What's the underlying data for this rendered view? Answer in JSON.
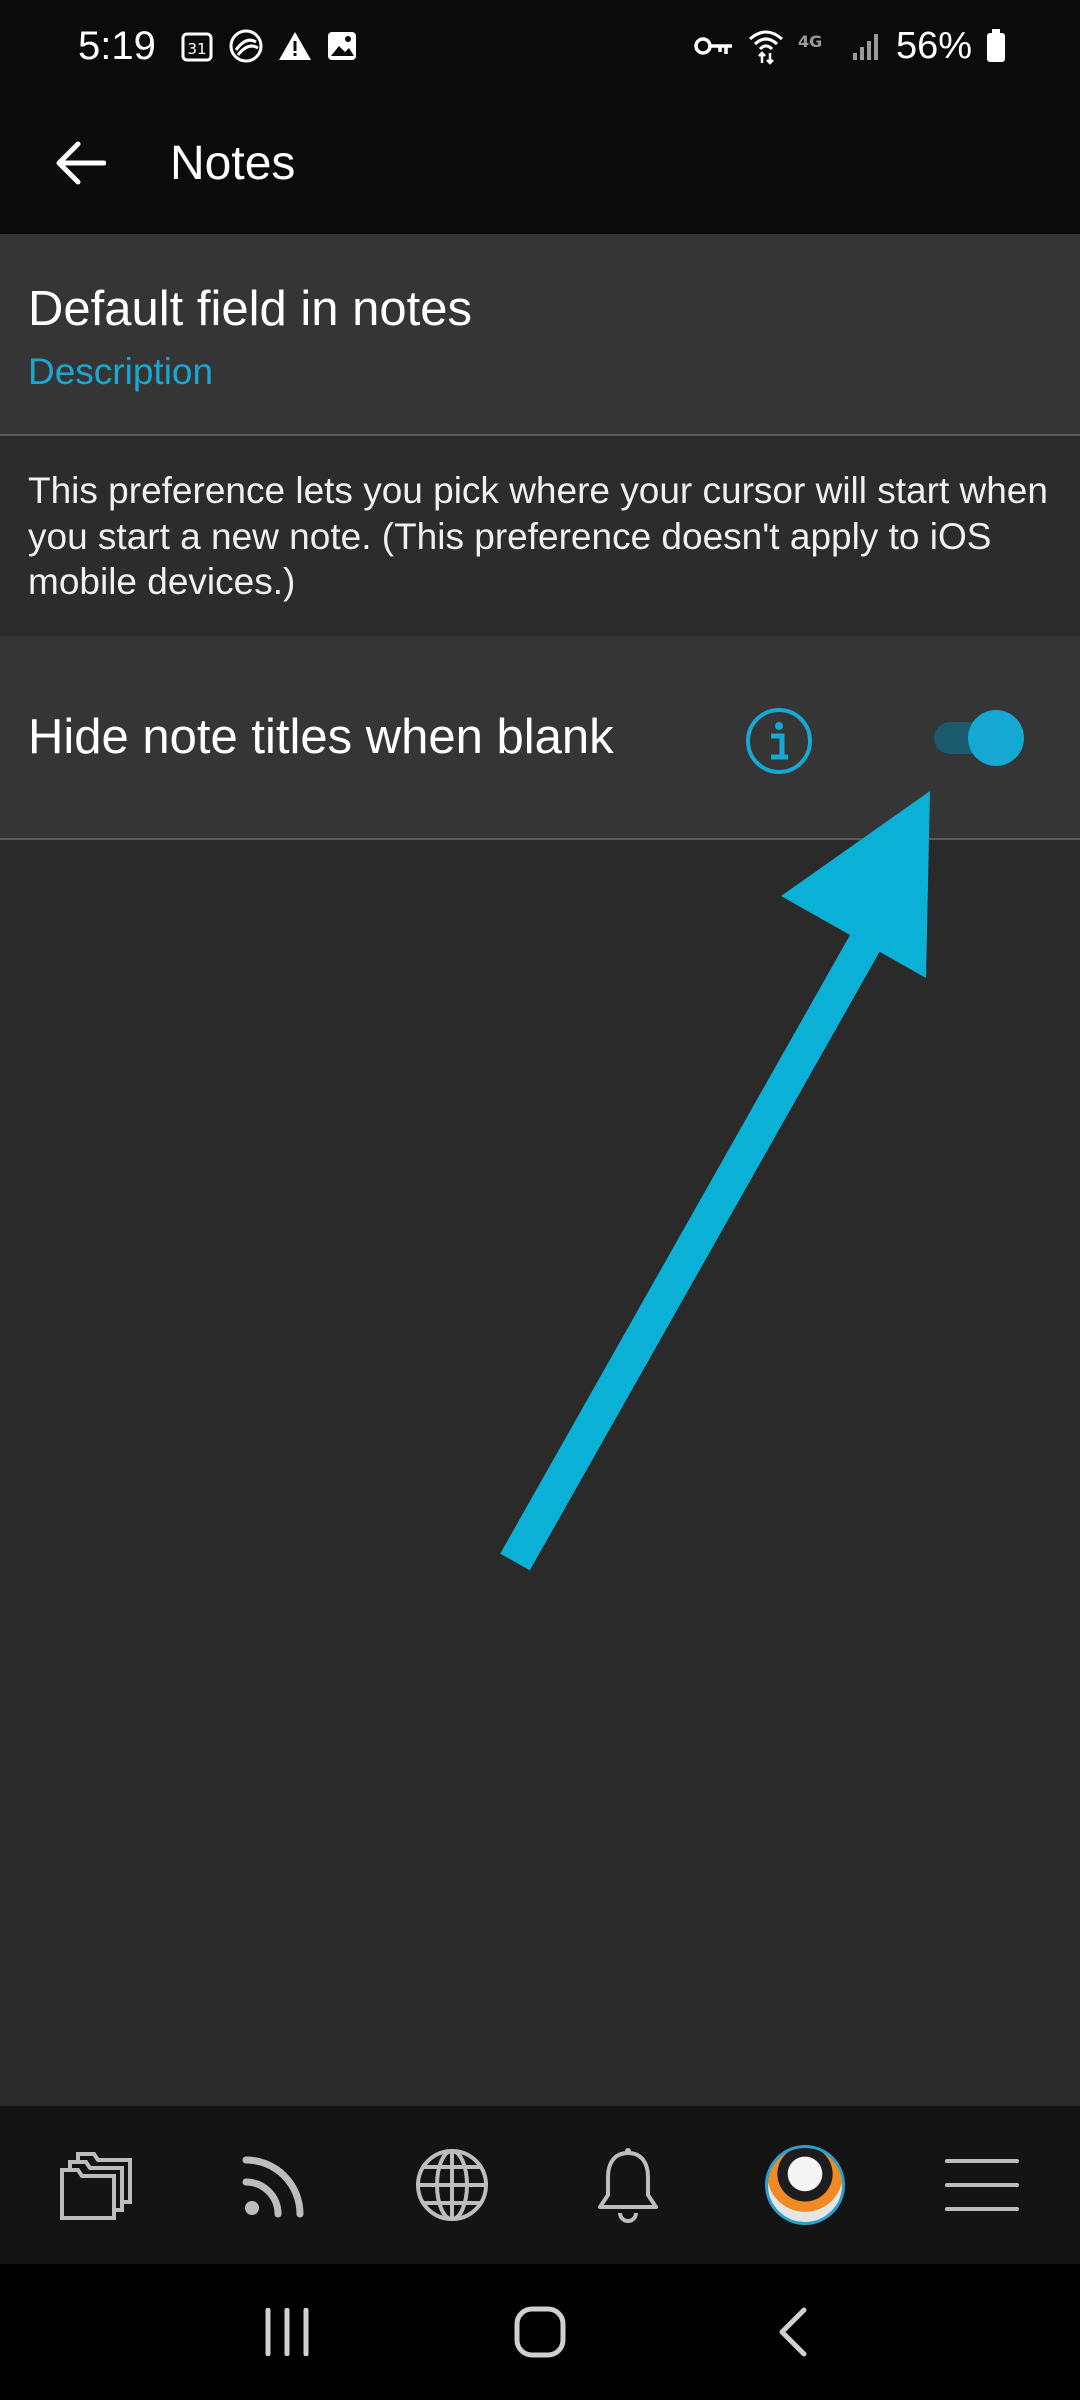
{
  "status_bar": {
    "time": "5:19",
    "calendar_day": "31",
    "network": "4G",
    "battery": "56%"
  },
  "app_bar": {
    "title": "Notes"
  },
  "settings": {
    "default_field": {
      "title": "Default field in notes",
      "value": "Description"
    },
    "description": "This preference lets you pick where your cursor will start when you start a new note. (This preference doesn't apply to iOS mobile devices.)",
    "hide_titles": {
      "label": "Hide note titles when blank",
      "enabled": true
    }
  },
  "colors": {
    "accent": "#14a8d2",
    "background": "#2a2a2a",
    "row": "#353535",
    "bar": "#0b0b0b"
  },
  "bottom_nav": [
    {
      "icon": "folders-icon"
    },
    {
      "icon": "feed-icon"
    },
    {
      "icon": "globe-icon"
    },
    {
      "icon": "bell-icon"
    },
    {
      "icon": "avatar"
    },
    {
      "icon": "menu-icon"
    }
  ],
  "system_nav": [
    {
      "icon": "recent-apps-icon"
    },
    {
      "icon": "home-icon"
    },
    {
      "icon": "back-icon"
    }
  ]
}
